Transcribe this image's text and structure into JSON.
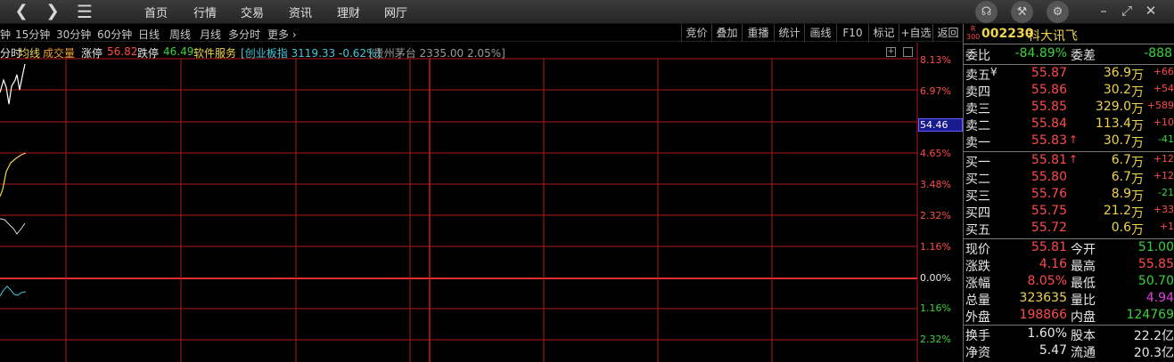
{
  "topbar": {
    "back_icon": "chevron-left-icon",
    "forward_icon": "chevron-right-icon",
    "menu_icon": "hamburger-icon",
    "menu": [
      "首页",
      "行情",
      "交易",
      "资讯",
      "理财",
      "网厅"
    ],
    "icons": [
      "headset-icon",
      "wrench-icon",
      "gear-icon"
    ],
    "window_controls": [
      "minimize-icon",
      "restore-icon",
      "close-icon"
    ]
  },
  "periods": [
    "钟",
    "15分钟",
    "30分钟",
    "60分钟",
    "日线",
    "周线",
    "月线",
    "多分时",
    "更多"
  ],
  "tools": [
    "竞价",
    "叠加",
    "重播",
    "统计",
    "画线",
    "F10",
    "标记",
    "+自选",
    "返回"
  ],
  "legend": {
    "tab": "分时",
    "avg": "均线",
    "vol": "成交量",
    "zt_label": "涨停",
    "zt_value": "56.82",
    "dt_label": "跌停",
    "dt_value": "46.49",
    "sector": "软件服务",
    "index_name": "创业板指",
    "index_value": "3119.33",
    "index_pct": "-0.62%",
    "stock2_name": "贵州茅台",
    "stock2_value": "2335.00",
    "stock2_pct": "2.05%"
  },
  "chart_data": {
    "type": "line",
    "y_axis_labels": [
      {
        "text": "8.13%",
        "color": "#ff4a4a"
      },
      {
        "text": "6.97%",
        "color": "#ff4a4a"
      },
      {
        "text": "4.65%",
        "color": "#ff4a4a"
      },
      {
        "text": "3.48%",
        "color": "#ff4a4a"
      },
      {
        "text": "2.32%",
        "color": "#ff4a4a"
      },
      {
        "text": "1.16%",
        "color": "#ff4a4a"
      },
      {
        "text": "0.00%",
        "color": "#e8e8e8"
      },
      {
        "text": "1.16%",
        "color": "#3ad23a"
      },
      {
        "text": "2.32%",
        "color": "#3ad23a"
      }
    ],
    "cursor_price": "54.46"
  },
  "stock": {
    "code": "002230",
    "name": "科大讯飞",
    "badge_top": "R",
    "badge_bottom": "300"
  },
  "weibi": {
    "label": "委比",
    "value": "-84.89%",
    "label2": "委差",
    "value2": "-888"
  },
  "asks": [
    {
      "label": "卖五",
      "mark": "¥",
      "price": "55.87",
      "vol": "36.9",
      "unit": "万",
      "chg": "+66",
      "chg_color": "red"
    },
    {
      "label": "卖四",
      "mark": "",
      "price": "55.86",
      "vol": "30.2",
      "unit": "万",
      "chg": "+54",
      "chg_color": "red"
    },
    {
      "label": "卖三",
      "mark": "",
      "price": "55.85",
      "vol": "329.0",
      "unit": "万",
      "chg": "+589",
      "chg_color": "red"
    },
    {
      "label": "卖二",
      "mark": "",
      "price": "55.84",
      "vol": "113.4",
      "unit": "万",
      "chg": "+10",
      "chg_color": "red"
    },
    {
      "label": "卖一",
      "mark": "",
      "price": "55.83",
      "vol": "30.7",
      "unit": "万",
      "chg": "-41",
      "chg_color": "green",
      "arrow": "↑"
    }
  ],
  "bids": [
    {
      "label": "买一",
      "price": "55.81",
      "vol": "6.7",
      "unit": "万",
      "chg": "+12",
      "chg_color": "red",
      "arrow": "↑"
    },
    {
      "label": "买二",
      "price": "55.80",
      "vol": "6.7",
      "unit": "万",
      "chg": "+12",
      "chg_color": "red"
    },
    {
      "label": "买三",
      "price": "55.76",
      "vol": "8.9",
      "unit": "万",
      "chg": "-21",
      "chg_color": "green"
    },
    {
      "label": "买四",
      "price": "55.75",
      "vol": "21.2",
      "unit": "万",
      "chg": "+33",
      "chg_color": "red"
    },
    {
      "label": "买五",
      "price": "55.72",
      "vol": "0.6",
      "unit": "万",
      "chg": "+1",
      "chg_color": "red"
    }
  ],
  "stats": [
    {
      "l1": "现价",
      "v1": "55.81",
      "c1": "red",
      "l2": "今开",
      "v2": "51.00",
      "c2": "green"
    },
    {
      "l1": "涨跌",
      "v1": "4.16",
      "c1": "red",
      "l2": "最高",
      "v2": "55.85",
      "c2": "red"
    },
    {
      "l1": "涨幅",
      "v1": "8.05%",
      "c1": "red",
      "l2": "最低",
      "v2": "50.70",
      "c2": "green"
    },
    {
      "l1": "总量",
      "v1": "323635",
      "c1": "yellow",
      "l2": "量比",
      "v2": "4.94",
      "c2": "purple"
    },
    {
      "l1": "外盘",
      "v1": "198866",
      "c1": "red",
      "l2": "内盘",
      "v2": "124769",
      "c2": "green"
    }
  ],
  "stats2": [
    {
      "l1": "换手",
      "v1": "1.60%",
      "c1": "white",
      "l2": "股本",
      "v2": "22.2亿",
      "c2": "white"
    },
    {
      "l1": "净资",
      "v1": "5.47",
      "c1": "white",
      "l2": "流通",
      "v2": "20.3亿",
      "c2": "white"
    }
  ]
}
